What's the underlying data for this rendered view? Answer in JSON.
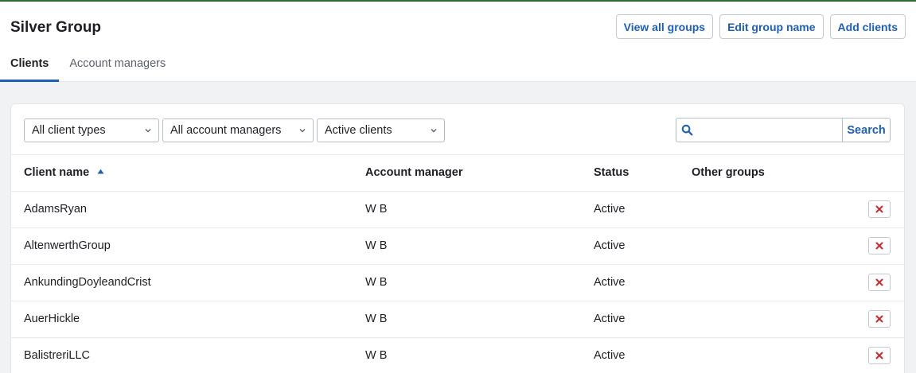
{
  "page": {
    "title": "Silver Group"
  },
  "actions": {
    "view_all_groups": "View all groups",
    "edit_group_name": "Edit group name",
    "add_clients": "Add clients"
  },
  "tabs": [
    {
      "label": "Clients",
      "active": true
    },
    {
      "label": "Account managers",
      "active": false
    }
  ],
  "filters": {
    "client_type": "All client types",
    "account_manager": "All account managers",
    "client_status": "Active clients"
  },
  "search": {
    "value": "",
    "placeholder": "",
    "button_label": "Search"
  },
  "table": {
    "columns": [
      "Client name",
      "Account manager",
      "Status",
      "Other groups"
    ],
    "sort_column": "Client name",
    "sort_direction": "ascending",
    "rows": [
      {
        "client_name": "AdamsRyan",
        "account_manager": "W B",
        "status": "Active",
        "other_groups": ""
      },
      {
        "client_name": "AltenwerthGroup",
        "account_manager": "W B",
        "status": "Active",
        "other_groups": ""
      },
      {
        "client_name": "AnkundingDoyleandCrist",
        "account_manager": "W B",
        "status": "Active",
        "other_groups": ""
      },
      {
        "client_name": "AuerHickle",
        "account_manager": "W B",
        "status": "Active",
        "other_groups": ""
      },
      {
        "client_name": "BalistreriLLC",
        "account_manager": "W B",
        "status": "Active",
        "other_groups": ""
      }
    ]
  },
  "icons": {
    "search": "search-icon",
    "remove": "close-icon",
    "sort": "sort-ascending-icon",
    "dropdown": "chevron-down-icon"
  },
  "colors": {
    "accent": "#1d5fb4",
    "remove": "#d0262d",
    "top_border": "#2f6b2f"
  }
}
